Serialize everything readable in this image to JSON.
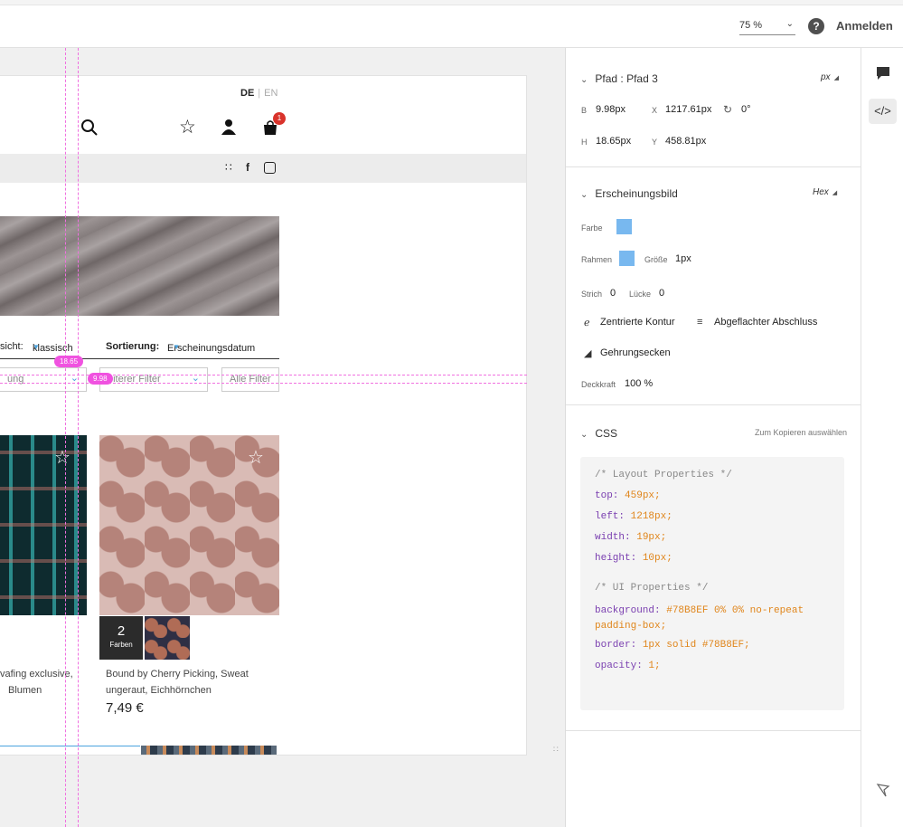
{
  "topbar": {
    "zoom": "75 %",
    "help": "?",
    "signin": "Anmelden"
  },
  "artboard": {
    "lang_de": "DE",
    "lang_sep": "|",
    "lang_en": "EN",
    "cart_count": "1",
    "view_label": "sicht:",
    "view_value": "klassisch",
    "sort_label": "Sortierung:",
    "sort_value": "Erscheinungsdatum",
    "filter1": "ung",
    "filter2": "eiterer Filter",
    "filter3": "Alle Filter",
    "swatch_count": "2",
    "swatch_label": "Farben",
    "product1_line1": "vafing exclusive,",
    "product1_line2": "Blumen",
    "product2_line1": "Bound by Cherry Picking, Sweat",
    "product2_line2": "ungeraut, Eichhörnchen",
    "price": "7,49 €",
    "measure_height": "18.65",
    "measure_width": "9.98"
  },
  "panel": {
    "path": {
      "title": "Pfad : Pfad 3",
      "unit": "px",
      "b_label": "B",
      "b_value": "9.98px",
      "x_label": "X",
      "x_value": "1217.61px",
      "rot_value": "0°",
      "h_label": "H",
      "h_value": "18.65px",
      "y_label": "Y",
      "y_value": "458.81px"
    },
    "appearance": {
      "title": "Erscheinungsbild",
      "unit": "Hex",
      "fill_label": "Farbe",
      "border_label": "Rahmen",
      "size_label": "Größe",
      "size_value": "1px",
      "stroke_label": "Strich",
      "stroke_value": "0",
      "gap_label": "Lücke",
      "gap_value": "0",
      "centered": "Zentrierte Kontur",
      "flat_end": "Abgeflachter Abschluss",
      "miter": "Gehrungsecken",
      "opacity_label": "Deckkraft",
      "opacity_value": "100 %",
      "color": "#78B8EF"
    },
    "css": {
      "title": "CSS",
      "copy_hint": "Zum Kopieren auswählen",
      "comment1": "/* Layout Properties */",
      "top_prop": "top:",
      "top_val": "459px;",
      "left_prop": "left:",
      "left_val": "1218px;",
      "width_prop": "width:",
      "width_val": "19px;",
      "height_prop": "height:",
      "height_val": "10px;",
      "comment2": "/* UI Properties */",
      "bg_prop": "background:",
      "bg_val": "#78B8EF 0% 0% no-repeat padding-box;",
      "border_prop": "border:",
      "border_val": "1px solid #78B8EF;",
      "opacity_prop": "opacity:",
      "opacity_val": "1;"
    }
  },
  "icons": {
    "comment": "comment-icon",
    "code": "code-icon",
    "flag": "flag-icon"
  }
}
